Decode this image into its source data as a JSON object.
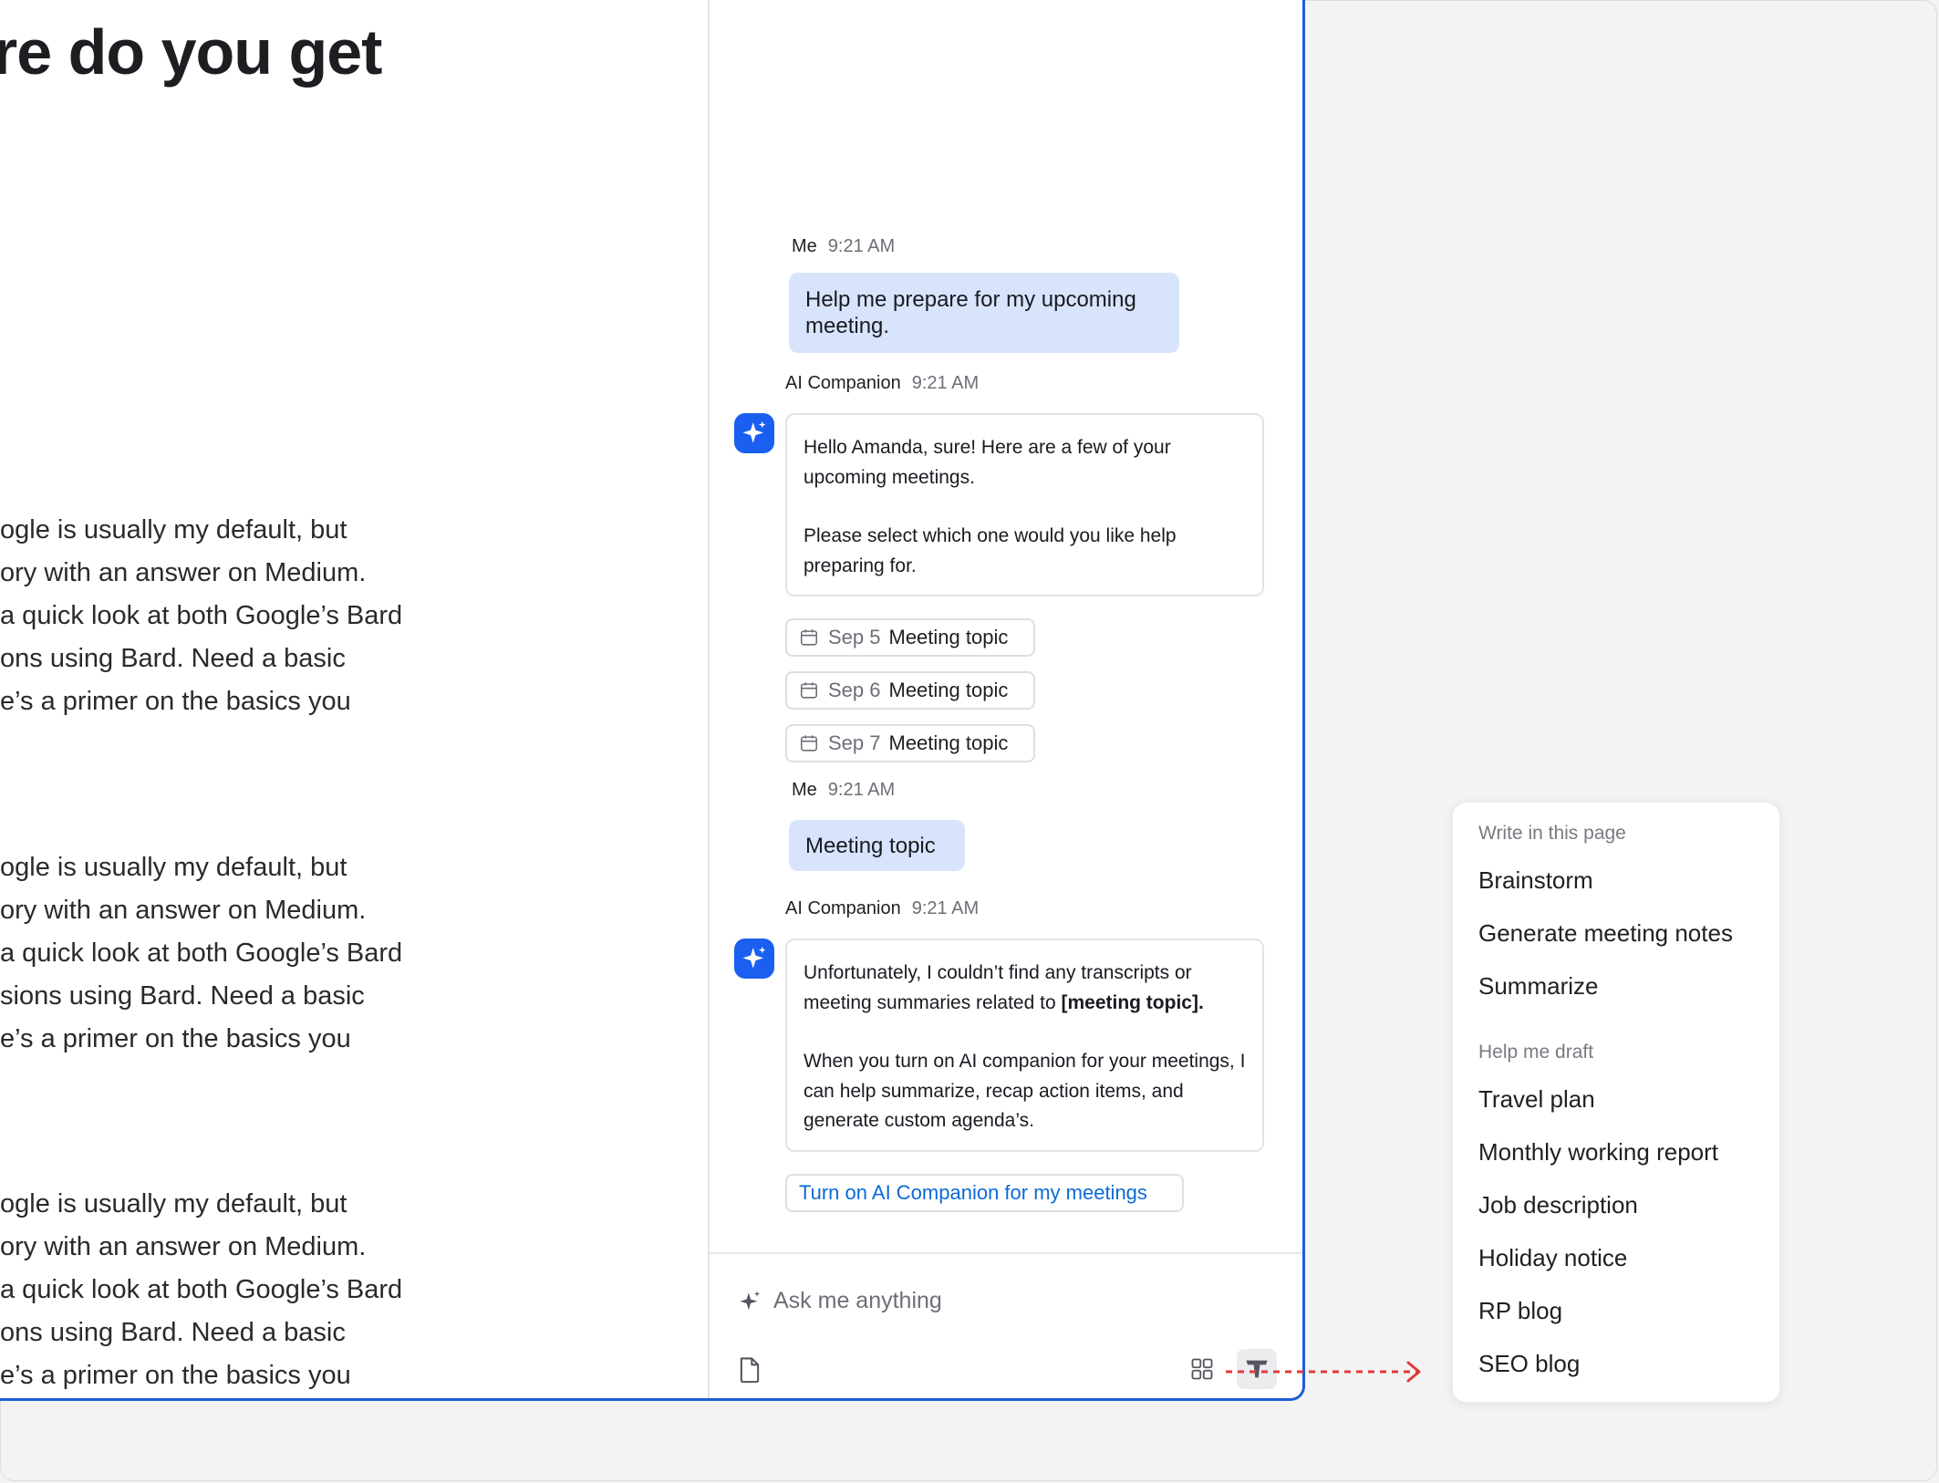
{
  "document": {
    "heading": "re do you get",
    "paragraphs": [
      {
        "lines": [
          "ogle is usually my default, but",
          "ory with an answer on Medium.",
          "a quick look at both Google’s Bard",
          "ons using Bard. Need a basic",
          "e’s a primer on the basics you"
        ]
      },
      {
        "lines": [
          "ogle is usually my default, but",
          "ory with an answer on Medium.",
          "a quick look at both Google’s Bard",
          "sions using Bard. Need a basic",
          "e’s a primer on the basics you"
        ]
      },
      {
        "lines": [
          "ogle is usually my default, but",
          "ory with an answer on Medium.",
          "a quick look at both Google’s Bard",
          "ons using Bard. Need a basic",
          "e’s a primer on the basics you"
        ]
      }
    ]
  },
  "chat": {
    "messages": [
      {
        "sender": "Me",
        "time": "9:21 AM",
        "text": "Help me prepare for my upcoming meeting."
      },
      {
        "sender": "AI Companion",
        "time": "9:21 AM",
        "p1": "Hello Amanda, sure! Here are a few of your upcoming meetings.",
        "p2": "Please select which one would you like help preparing for."
      },
      {
        "sender": "Me",
        "time": "9:21 AM",
        "text": "Meeting topic"
      },
      {
        "sender": "AI Companion",
        "time": "9:21 AM",
        "p1_pre": "Unfortunately, I couldn’t find any transcripts or meeting summaries related to ",
        "p1_bold": "[meeting topic].",
        "p2": "When you turn on AI companion for your meetings, I can help summarize, recap action items, and generate custom agenda’s."
      }
    ],
    "meeting_options": [
      {
        "date": "Sep 5",
        "topic": "Meeting topic"
      },
      {
        "date": "Sep 6",
        "topic": "Meeting topic"
      },
      {
        "date": "Sep 7",
        "topic": "Meeting topic"
      }
    ],
    "turn_on_label": "Turn on AI Companion for my meetings",
    "composer": {
      "placeholder": "Ask me anything"
    }
  },
  "menu": {
    "sections": [
      {
        "title": "Write in this page",
        "items": [
          "Brainstorm",
          "Generate meeting notes",
          "Summarize"
        ]
      },
      {
        "title": "Help me draft",
        "items": [
          "Travel plan",
          "Monthly working report",
          "Job description",
          "Holiday notice",
          "RP blog",
          "SEO blog"
        ]
      }
    ]
  },
  "colors": {
    "accent": "#1a5ff0",
    "window_border": "#1f5fd6",
    "user_bubble": "#d8e4fb",
    "link": "#0b6ad6",
    "connector": "#e03a3a"
  },
  "icons": [
    "sparkle-icon",
    "calendar-icon",
    "file-icon",
    "grid-icon",
    "text-format-icon",
    "arrow-right-icon"
  ]
}
